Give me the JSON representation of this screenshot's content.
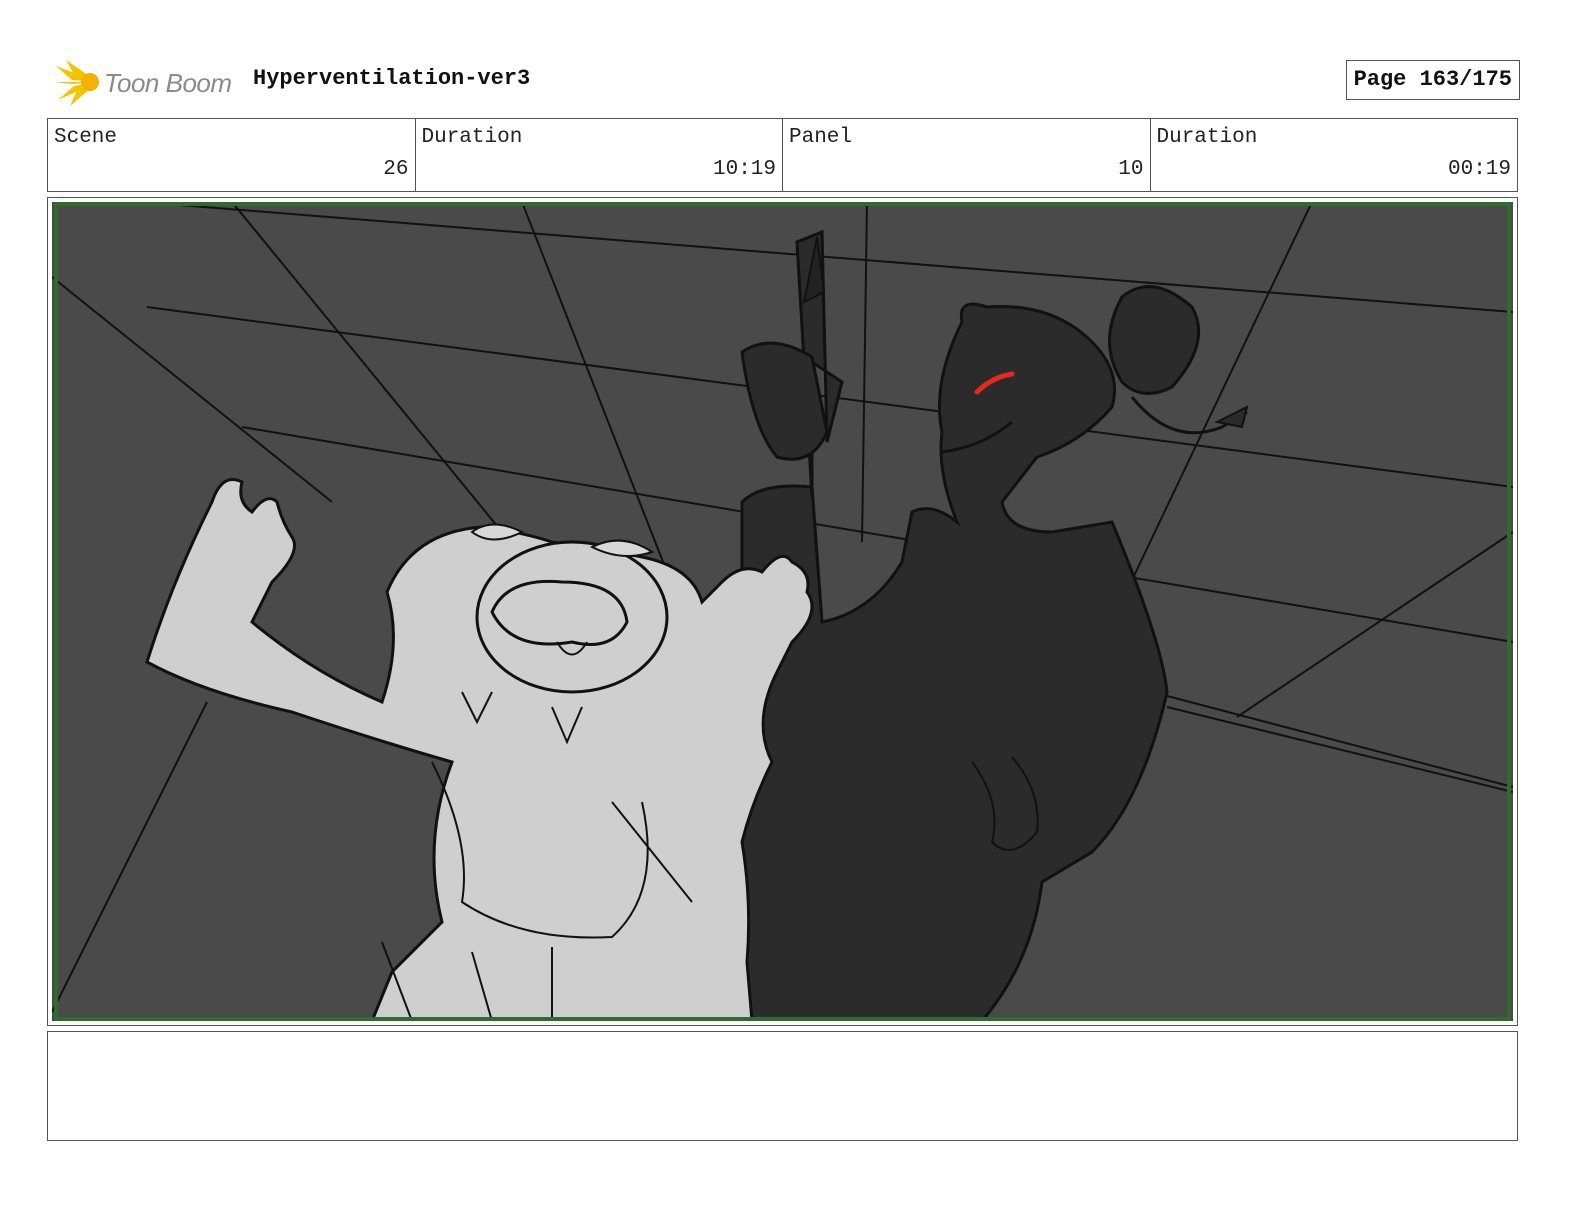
{
  "header": {
    "logo_text": "Toon Boom",
    "project_title": "Hyperventilation-ver3",
    "page_label": "Page 163/175"
  },
  "info": {
    "scene_label": "Scene",
    "scene_value": "26",
    "scene_duration_label": "Duration",
    "scene_duration_value": "10:19",
    "panel_label": "Panel",
    "panel_value": "10",
    "panel_duration_label": "Duration",
    "panel_duration_value": "00:19"
  },
  "panel": {
    "image_label": "storyboard-panel-drawing",
    "colors": {
      "background": "#4a4a4a",
      "safe_frame": "#2e6b2e",
      "light_character": "#cfcfcf",
      "dark_character": "#2b2b2b",
      "eye": "#e8281e"
    }
  },
  "notes": {
    "text": ""
  }
}
